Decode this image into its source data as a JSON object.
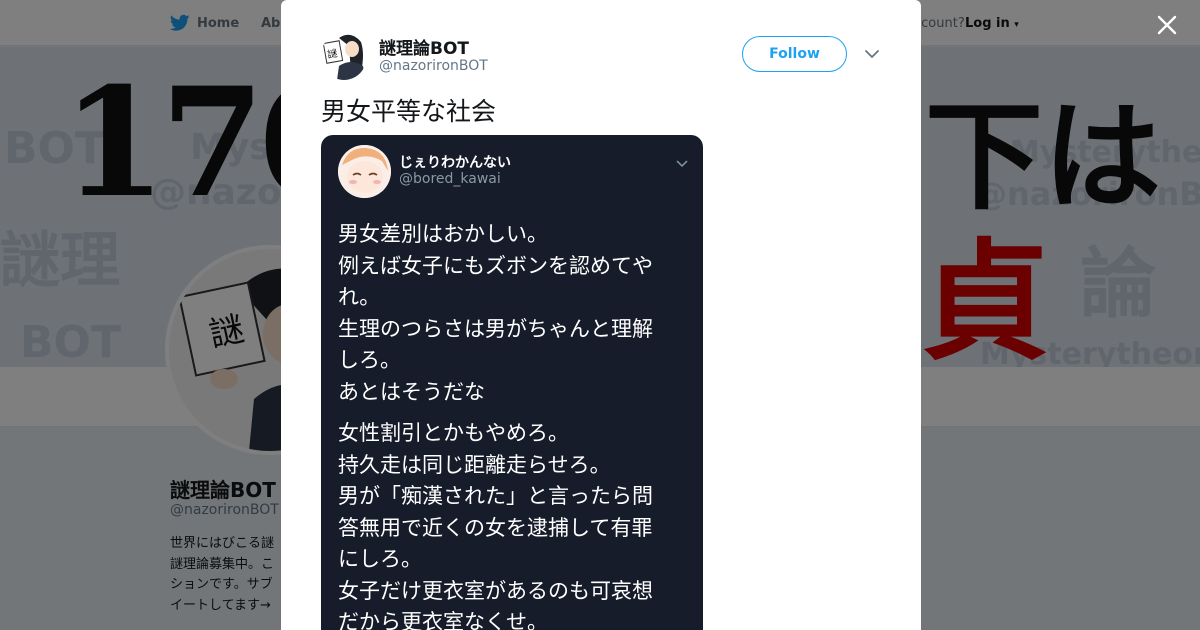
{
  "colors": {
    "twitter_blue": "#1da1f2",
    "overlay": "rgba(0,0,0,0.5)",
    "screenshot_bg": "#161c2a"
  },
  "background_page": {
    "nav": {
      "home": "Home",
      "about": "Abo",
      "account_question": "ccount?",
      "login": "Log in",
      "twitter_icon": "bird-icon",
      "login_caret_icon": "caret-down-icon"
    },
    "banner": {
      "big_left": "170",
      "big_right": "下は",
      "red_char": "貞",
      "faint_1": "Mystery",
      "faint_2": "@nazoriron",
      "faint_3": "謎理",
      "faint_4": "BOT",
      "faint_5": "Mysterytheory",
      "faint_6": "@nazorironBOT",
      "faint_7": "論"
    },
    "profile": {
      "name": "謎理論BOT",
      "handle": "@nazorironBOT",
      "bio": "世界にはびこる謎\n謎理論募集中。こ\nションです。サブ\nイートしてます→"
    }
  },
  "modal": {
    "author_name": "謎理論BOT",
    "author_handle": "@nazorironBOT",
    "follow_label": "Follow",
    "tweet_text": "男女平等な社会",
    "screenshot": {
      "name": "じぇりわかんない",
      "handle": "@bored_kawai",
      "paragraph1": "男女差別はおかしい。\n例えば女子にもズボンを認めてや\nれ。\n生理のつらさは男がちゃんと理解\nしろ。\nあとはそうだな",
      "paragraph2": "女性割引とかもやめろ。\n持久走は同じ距離走らせろ。\n男が「痴漢された」と言ったら問\n答無用で近くの女を逮捕して有罪\nにしろ。\n女子だけ更衣室があるのも可哀想\nだから更衣室なくせ。"
    }
  },
  "icons": {
    "close": "close-icon",
    "caret": "chevron-down-icon",
    "avatar_label": "謎"
  }
}
